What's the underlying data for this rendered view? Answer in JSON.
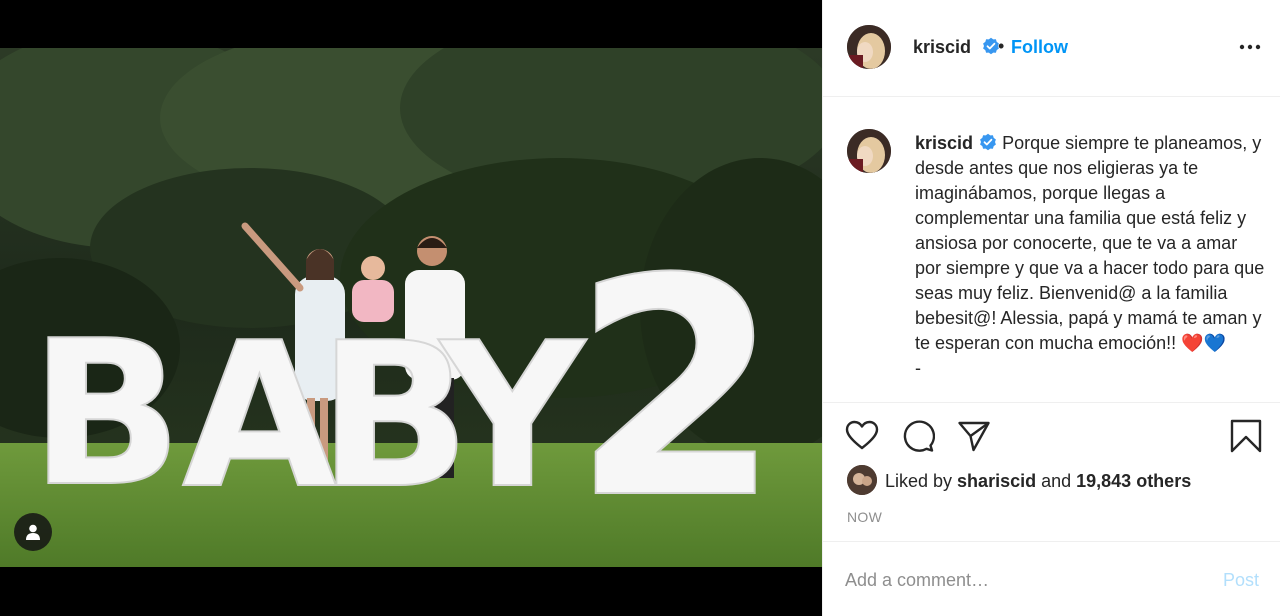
{
  "header": {
    "username": "kriscid",
    "separator": "•",
    "follow_label": "Follow"
  },
  "caption": {
    "username": "kriscid",
    "text": "Porque siempre te planeamos, y desde antes que nos eligieras ya te imaginábamos, porque llegas a complementar una familia que está feliz y ansiosa por conocerte, que te va a amar por siempre y que va a hacer todo para que seas muy feliz. Bienvenid@ a la familia bebesit@! Alessia, papá y mamá te aman y te esperan con mucha emoción!! ❤️💙\n-"
  },
  "likes": {
    "prefix": "Liked by ",
    "liker": "shariscid",
    "middle": " and ",
    "count": "19,843 others"
  },
  "timestamp": "NOW",
  "comment": {
    "placeholder": "Add a comment…",
    "post_label": "Post"
  },
  "photo": {
    "sign_letters": [
      "B",
      "A",
      "B",
      "Y"
    ],
    "sign_number": "2"
  },
  "icons": {
    "verified": "verified-badge-icon",
    "more": "more-options-icon",
    "like": "heart-icon",
    "comment": "comment-icon",
    "share": "share-icon",
    "save": "bookmark-icon",
    "user_tag": "user-tag-icon"
  },
  "colors": {
    "link": "#0095f6",
    "verified": "#3897f0",
    "post_disabled": "#b2dffc",
    "muted": "#8e8e8e"
  }
}
